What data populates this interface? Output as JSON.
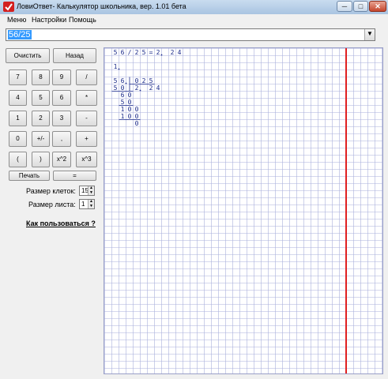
{
  "window": {
    "title": "ЛовиОтвет- Калькулятор школьника, вер.  1.01 бета",
    "min_glyph": "─",
    "max_glyph": "□",
    "close_glyph": "✕"
  },
  "menu": [
    "Меню",
    "Настройки",
    "Помощь"
  ],
  "expression": {
    "value": "56/25",
    "dropdown_glyph": "▼"
  },
  "keypad": {
    "clear": "Очистить",
    "back": "Назад",
    "keys": [
      [
        "7",
        "8",
        "9",
        "/"
      ],
      [
        "4",
        "5",
        "6",
        "*"
      ],
      [
        "1",
        "2",
        "3",
        "-"
      ],
      [
        "0",
        "+/-",
        ",",
        "+"
      ],
      [
        "(",
        ")",
        "x^2",
        "x^3"
      ]
    ],
    "print": "Печать",
    "equals": "="
  },
  "settings": {
    "cell_size_label": "Размер клеток:",
    "cell_size_value": "15",
    "sheet_size_label": "Размер листа:",
    "sheet_size_value": "1",
    "up_glyph": "▲",
    "down_glyph": "▼"
  },
  "help_link": "Как пользоваться ?",
  "worksheet": {
    "colors": {
      "grid": "#aab0dc",
      "digits": "#1a2a8a",
      "margin": "#e02020"
    },
    "rows": [
      {
        "row": 1,
        "col": 1,
        "text": "56/25=2,24"
      },
      {
        "row": 3,
        "col": 1,
        "text": "1."
      },
      {
        "row": 5,
        "col": 1,
        "text": "56,025"
      },
      {
        "row": 6,
        "col": 1,
        "text": "50"
      },
      {
        "row": 6,
        "col": 4,
        "text": "2,24"
      },
      {
        "row": 7,
        "col": 2,
        "text": "60"
      },
      {
        "row": 8,
        "col": 2,
        "text": "50"
      },
      {
        "row": 9,
        "col": 2,
        "text": "100"
      },
      {
        "row": 10,
        "col": 2,
        "text": "100"
      },
      {
        "row": 11,
        "col": 4,
        "text": "0"
      }
    ]
  }
}
